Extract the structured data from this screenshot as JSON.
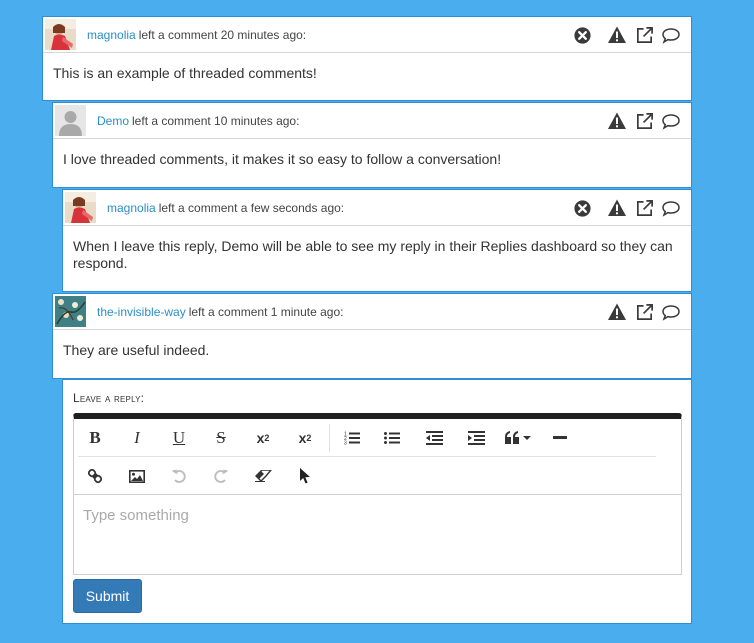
{
  "comments": [
    {
      "user": "magnolia",
      "meta": "left a comment 20 minutes ago:",
      "body": "This is an example of threaded comments!",
      "avatar": "magnolia-avatar",
      "can_delete": true
    },
    {
      "user": "Demo",
      "meta": "left a comment 10 minutes ago:",
      "body": "I love threaded comments, it makes it so easy to follow a conversation!",
      "avatar": "default-avatar",
      "can_delete": false
    },
    {
      "user": "magnolia",
      "meta": "left a comment a few seconds ago:",
      "body": "When I leave this reply, Demo will be able to see my reply in their Replies dashboard so they can respond.",
      "avatar": "magnolia-avatar",
      "can_delete": true
    },
    {
      "user": "the-invisible-way",
      "meta": "left a comment 1 minute ago:",
      "body": "They are useful indeed.",
      "avatar": "painting-avatar",
      "can_delete": false
    }
  ],
  "reply": {
    "label": "Leave a reply:",
    "placeholder": "Type something",
    "submit_label": "Submit",
    "toolbar_row1": [
      "bold-icon",
      "italic-icon",
      "underline-icon",
      "strikethrough-icon",
      "subscript-icon",
      "superscript-icon",
      "ordered-list-icon",
      "unordered-list-icon",
      "outdent-icon",
      "indent-icon",
      "blockquote-icon",
      "horizontal-rule-icon"
    ],
    "toolbar_row2": [
      "link-icon",
      "image-icon",
      "undo-icon",
      "redo-icon",
      "eraser-icon",
      "pointer-icon"
    ]
  },
  "colors": {
    "background": "#4aadee",
    "link": "#2a8fc5",
    "submit": "#337ab7",
    "border": "#2f8fd6"
  }
}
